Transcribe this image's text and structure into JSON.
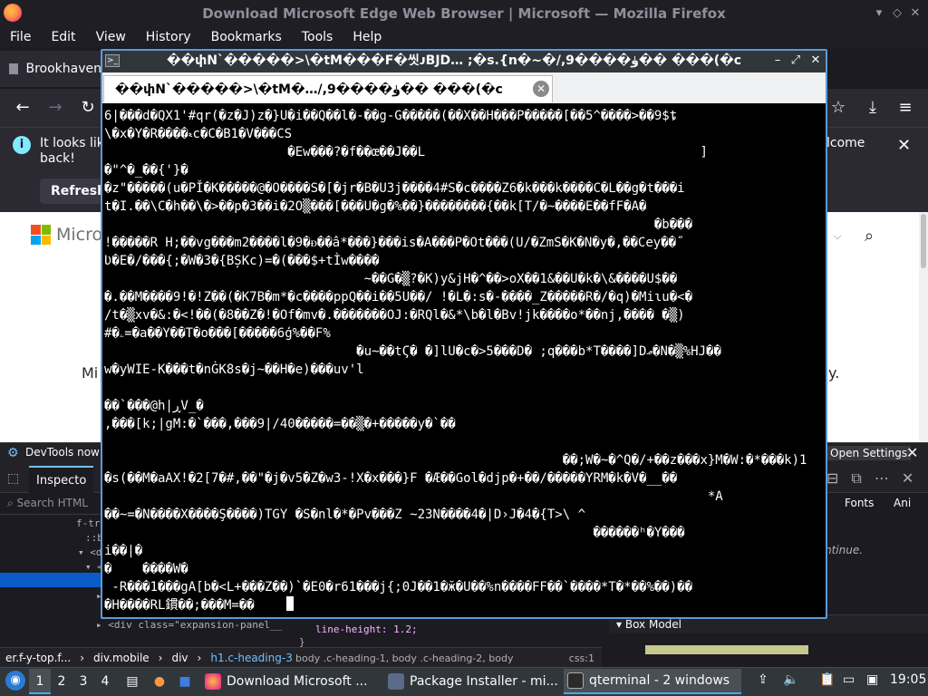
{
  "firefox": {
    "title": "Download Microsoft Edge Web Browser | Microsoft — Mozilla Firefox",
    "menu": [
      "File",
      "Edit",
      "View",
      "History",
      "Bookmarks",
      "Tools",
      "Help"
    ],
    "bookmark_tab": "Brookhaven",
    "infobar": {
      "text": "It looks lik back!",
      "refresh_label": "Refresh",
      "welcome_text": "lcome"
    },
    "page": {
      "ms_logo_text": "Micro",
      "body_left": "Mi",
      "body_right": "y."
    },
    "icons": {
      "back": "back-arrow-icon",
      "forward": "forward-arrow-icon",
      "reload": "reload-icon",
      "bookmark": "star-icon",
      "downloads": "download-icon",
      "menu": "hamburger-icon"
    }
  },
  "devtools": {
    "notice": "DevTools now f",
    "open_settings": "Open Settings",
    "inspector_tab": "Inspecto",
    "search_placeholder": "Search HTML",
    "html_lines": [
      "f-tr",
      "::b",
      "<di",
      "<",
      "",
      "",
      "",
      "",
      "<div class=\"expansion-panel__"
    ],
    "right_tabs": [
      "Fonts",
      "Ani"
    ],
    "continue_text": "ntinue.",
    "css_rule": "line-height: 1.2;",
    "css_brace": "}",
    "css_crumb": "body .c-heading-1, body .c-heading-2, body",
    "css_crumb_right": "css:1",
    "box_model": "Box Model",
    "breadcrumb": [
      "er.f-y-top.f...",
      "div.mobile",
      "div",
      "h1.c-heading-3"
    ]
  },
  "terminal": {
    "window_title": "��փN`�����>\\�tM���F�씻ᴊBJD…  ;�s.{n�~�/,9����ۈ�� ���(�c",
    "tab_title": "��փN`�����>\\�tM�…/,9����ۈ�� ���(�c",
    "lines": [
      "6|���d�QX1'#qr(�z�J)z�}U�i��Q��l�-��g-G�����(��X��H���P�����[��5^����>��9$ȶ",
      "\\�x�Y�R����ޑc�C�B1�V���CS",
      "                        �Ew���?�f��œ��J��L                                    ]",
      "�\"^�_��{'}�",
      "�z\"�����(u�PǏ�K�����@�O����S�[�jr�B�U3j����4#S�c����Z6�k���k����C�L��g�t���i",
      "t�I.��\\C�h��\\�>��p�3��i�2O▒���[���U�g�%��}��������{��k[T/�~����E��fF�A�",
      "                                                                        �b���",
      "!�����R H;��vg���m2����l�9�ᴆ��â*���}���is�A���P�Ot���(U/�ZmS�K�N�y�,��Cey��˝",
      "Ʋ�E�/���{;�W�3�{BȘKc)=�(���$+tÌw����",
      "                                  ~��G�▒?�K)y&jH�^��>oX��1&��U�k�\\&����U$��",
      "�.��M����9!�!Z��(�K7B�m*�c����ppQ��i��5U��/ !�L�:s�-����_Z�����R�/�q)�Miɩu�<�",
      "/t�▒xv�&:�<!��(�8��Z�!�Of�mv�.�������OJ:�RQl�&*\\b�l�Bv!jk����o*��nj,���� �▒)",
      "#�ۦ=�a��Y��T�o���[�����6ģ%��F%",
      "                                 �u~��tϚ� �]lU�c�>5���D� ;q���b*T����]Dޢ�N�▒%HJ��",
      "w�yWIE-K���t�nĠK8s�j~��H�e)���uv'l",
      "",
      "��`���@h|ڕV_�",
      ",���[k;|gM:�`���,���9|/40�����=��▒�+�����y�`��",
      "",
      "                                                            ��;W�~�^Q�/+��z���x}M�W:�*���k)1",
      "�s(��M�aAX!�2[7�#,��\"�j�v5�Z�w3-!X�x���}F �Æ��Gol�djp�+��/�����YRM�k�V�__��",
      "                                                                               *A",
      "��~=�N����X����Ş����)TGY �S�nl�*�Pv���Z ~2ЗN����4�|D›J�4�{T>\\ ^",
      "                                                                ������ʰ�Y���",
      "i��|�",
      "�    ����W�",
      " -R���1���gA[b�<L+���Z��)`�E0�r61���j{;0J��1�ӂ�U��%n����FF��`����*T�*��%��)��",
      "�H����RL鏆��;���M=��"
    ]
  },
  "taskbar": {
    "workspaces": [
      "1",
      "2",
      "3",
      "4"
    ],
    "apps": [
      {
        "label": "Download Microsoft ...",
        "icon": "firefox-icon"
      },
      {
        "label": "Package Installer - mi...",
        "icon": "package-icon"
      },
      {
        "label": "qterminal - 2 windows",
        "icon": "terminal-icon"
      }
    ],
    "clock": "19:05"
  }
}
